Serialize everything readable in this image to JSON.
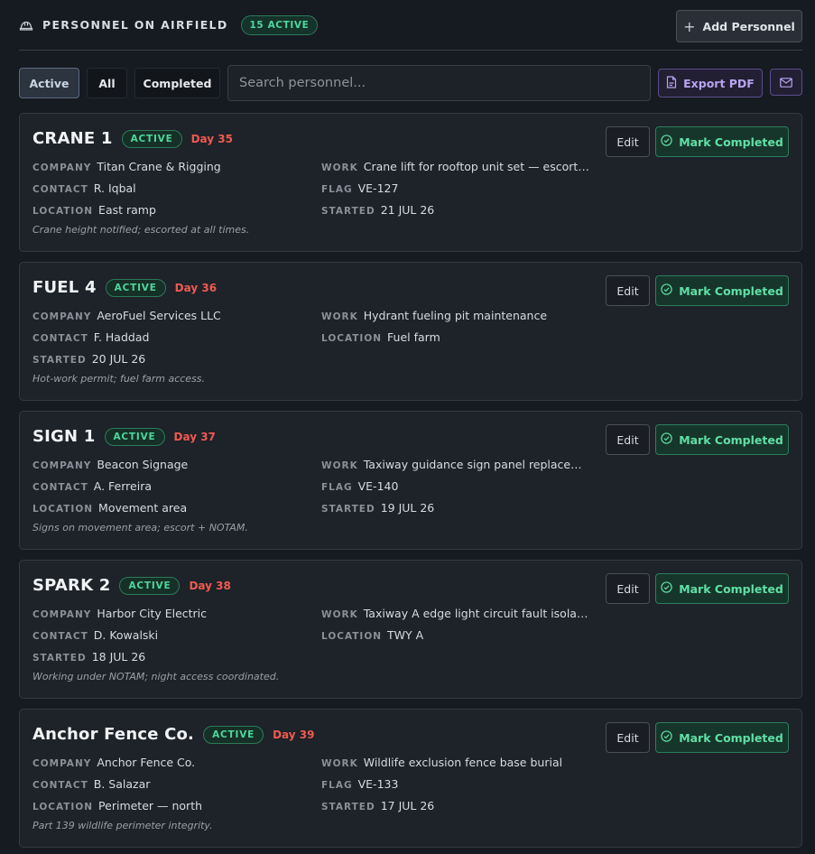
{
  "header": {
    "title": "PERSONNEL ON AIRFIELD",
    "count_badge": "15 ACTIVE",
    "add_button": "Add Personnel"
  },
  "toolbar": {
    "filters": [
      "Active",
      "All",
      "Completed"
    ],
    "selected_filter": "Active",
    "search_placeholder": "Search personnel...",
    "export_button": "Export PDF"
  },
  "card_labels": {
    "edit": "Edit",
    "mark_completed": "Mark Completed"
  },
  "cards": [
    {
      "name": "CRANE 1",
      "status": "ACTIVE",
      "day": "Day 35",
      "left": [
        {
          "k": "COMPANY",
          "v": "Titan Crane & Rigging"
        },
        {
          "k": "CONTACT",
          "v": "R. Iqbal"
        },
        {
          "k": "LOCATION",
          "v": "East ramp"
        }
      ],
      "right": [
        {
          "k": "WORK",
          "v": "Crane lift for rooftop unit set — escort req..."
        },
        {
          "k": "FLAG",
          "v": "VE-127"
        },
        {
          "k": "STARTED",
          "v": "21 JUL 26"
        }
      ],
      "note": "Crane height notified; escorted at all times."
    },
    {
      "name": "FUEL 4",
      "status": "ACTIVE",
      "day": "Day 36",
      "left": [
        {
          "k": "COMPANY",
          "v": "AeroFuel Services LLC"
        },
        {
          "k": "CONTACT",
          "v": "F. Haddad"
        },
        {
          "k": "STARTED",
          "v": "20 JUL 26"
        }
      ],
      "right": [
        {
          "k": "WORK",
          "v": "Hydrant fueling pit maintenance"
        },
        {
          "k": "LOCATION",
          "v": "Fuel farm"
        }
      ],
      "note": "Hot-work permit; fuel farm access."
    },
    {
      "name": "SIGN 1",
      "status": "ACTIVE",
      "day": "Day 37",
      "left": [
        {
          "k": "COMPANY",
          "v": "Beacon Signage"
        },
        {
          "k": "CONTACT",
          "v": "A. Ferreira"
        },
        {
          "k": "LOCATION",
          "v": "Movement area"
        }
      ],
      "right": [
        {
          "k": "WORK",
          "v": "Taxiway guidance sign panel replacement"
        },
        {
          "k": "FLAG",
          "v": "VE-140"
        },
        {
          "k": "STARTED",
          "v": "19 JUL 26"
        }
      ],
      "note": "Signs on movement area; escort + NOTAM."
    },
    {
      "name": "SPARK 2",
      "status": "ACTIVE",
      "day": "Day 38",
      "left": [
        {
          "k": "COMPANY",
          "v": "Harbor City Electric"
        },
        {
          "k": "CONTACT",
          "v": "D. Kowalski"
        },
        {
          "k": "STARTED",
          "v": "18 JUL 26"
        }
      ],
      "right": [
        {
          "k": "WORK",
          "v": "Taxiway A edge light circuit fault isolation"
        },
        {
          "k": "LOCATION",
          "v": "TWY A"
        }
      ],
      "note": "Working under NOTAM; night access coordinated."
    },
    {
      "name": "Anchor Fence Co.",
      "status": "ACTIVE",
      "day": "Day 39",
      "left": [
        {
          "k": "COMPANY",
          "v": "Anchor Fence Co."
        },
        {
          "k": "CONTACT",
          "v": "B. Salazar"
        },
        {
          "k": "LOCATION",
          "v": "Perimeter — north"
        }
      ],
      "right": [
        {
          "k": "WORK",
          "v": "Wildlife exclusion fence base burial"
        },
        {
          "k": "FLAG",
          "v": "VE-133"
        },
        {
          "k": "STARTED",
          "v": "17 JUL 26"
        }
      ],
      "note": "Part 139 wildlife perimeter integrity."
    }
  ],
  "colors": {
    "background": "#161a21",
    "card": "#1e2229",
    "active_green": "#4fd69c",
    "day_red": "#ef5a4f",
    "export_purple": "#b7a4f0"
  },
  "icons": {
    "header": "hard-hat-icon",
    "add": "plus-icon",
    "export": "pdf-file-icon",
    "email": "mail-icon",
    "complete": "check-circle-icon"
  }
}
